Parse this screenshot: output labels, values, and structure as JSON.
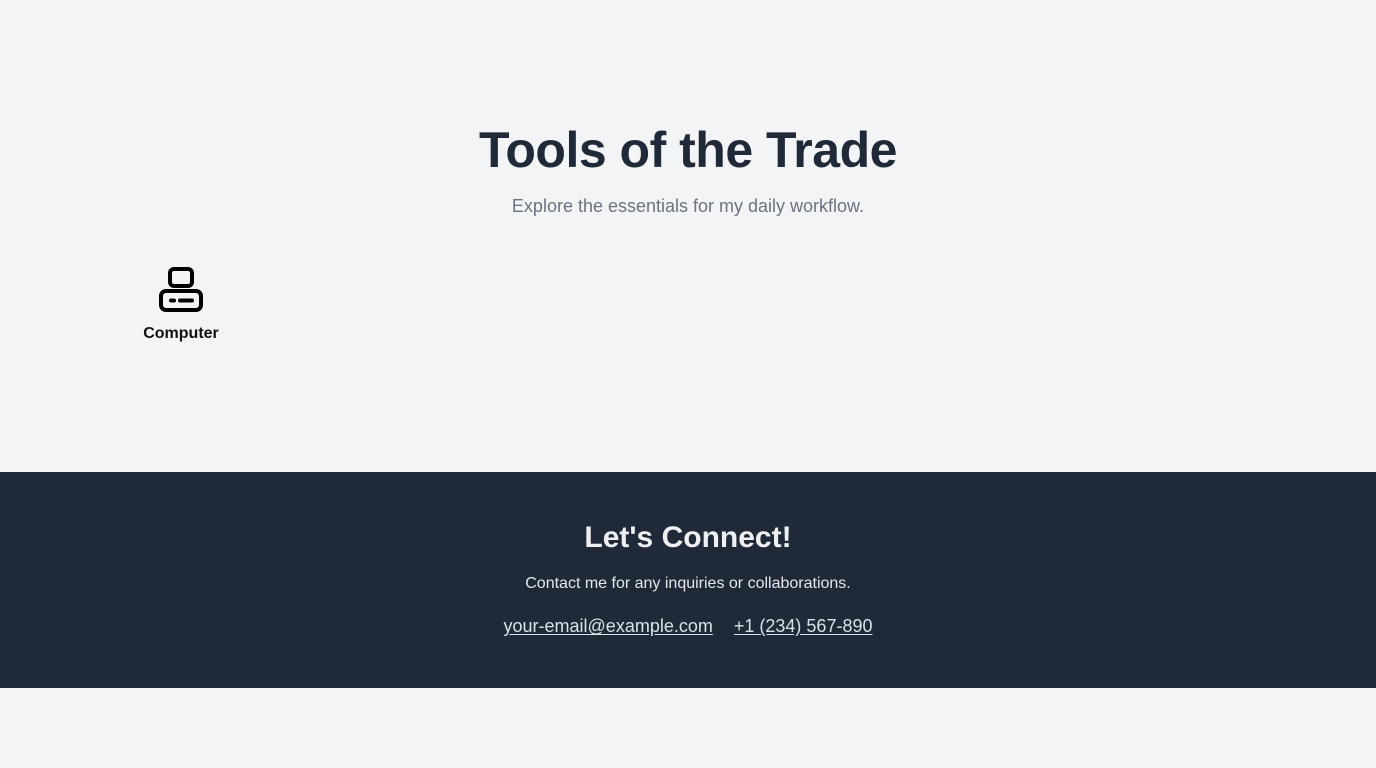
{
  "hero": {
    "title": "Tools of the Trade",
    "subtitle": "Explore the essentials for my daily workflow."
  },
  "tools": [
    {
      "label": "Computer",
      "icon": "computer-icon"
    }
  ],
  "footer": {
    "title": "Let's Connect!",
    "text": "Contact me for any inquiries or collaborations.",
    "email": "your-email@example.com",
    "phone": "+1 (234) 567-890"
  },
  "colors": {
    "page_background": "#f3f4f6",
    "heading": "#1f2937",
    "subtitle": "#6b7280",
    "footer_background": "#1f2937",
    "footer_text": "#e5e7eb"
  }
}
